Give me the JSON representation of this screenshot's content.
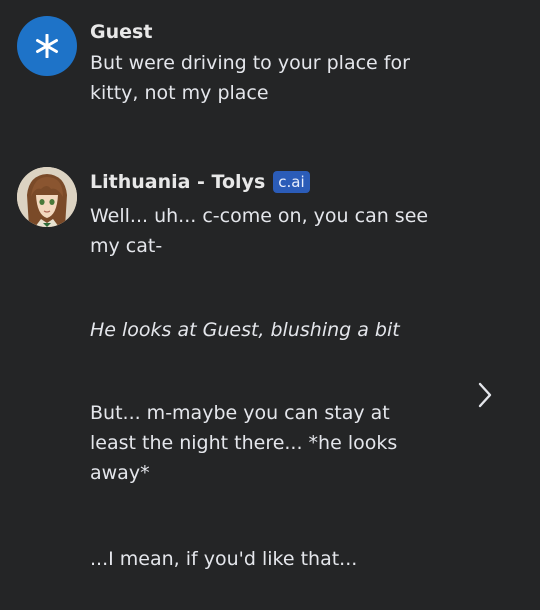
{
  "messages": [
    {
      "author": "Guest",
      "avatar_icon": "asterisk-icon",
      "avatar_color": "#1e73c8",
      "text": "But were driving to your place for kitty, not my place"
    },
    {
      "author": "Lithuania - Tolys",
      "badge": "c.ai",
      "avatar_icon": "character-portrait",
      "paragraphs": [
        {
          "text": "Well... uh... c-come on, you can see my cat-",
          "italic": false
        },
        {
          "text": "He looks at Guest, blushing a bit",
          "italic": true
        },
        {
          "text": "But... m-maybe you can stay at least the night there... *he looks away*",
          "italic": false
        },
        {
          "text": "...I mean, if you'd like that...",
          "italic": false
        }
      ]
    }
  ],
  "controls": {
    "next_icon": "chevron-right-icon"
  },
  "colors": {
    "background": "#242526",
    "text": "#e4e6eb",
    "badge": "#2b5cb8"
  }
}
